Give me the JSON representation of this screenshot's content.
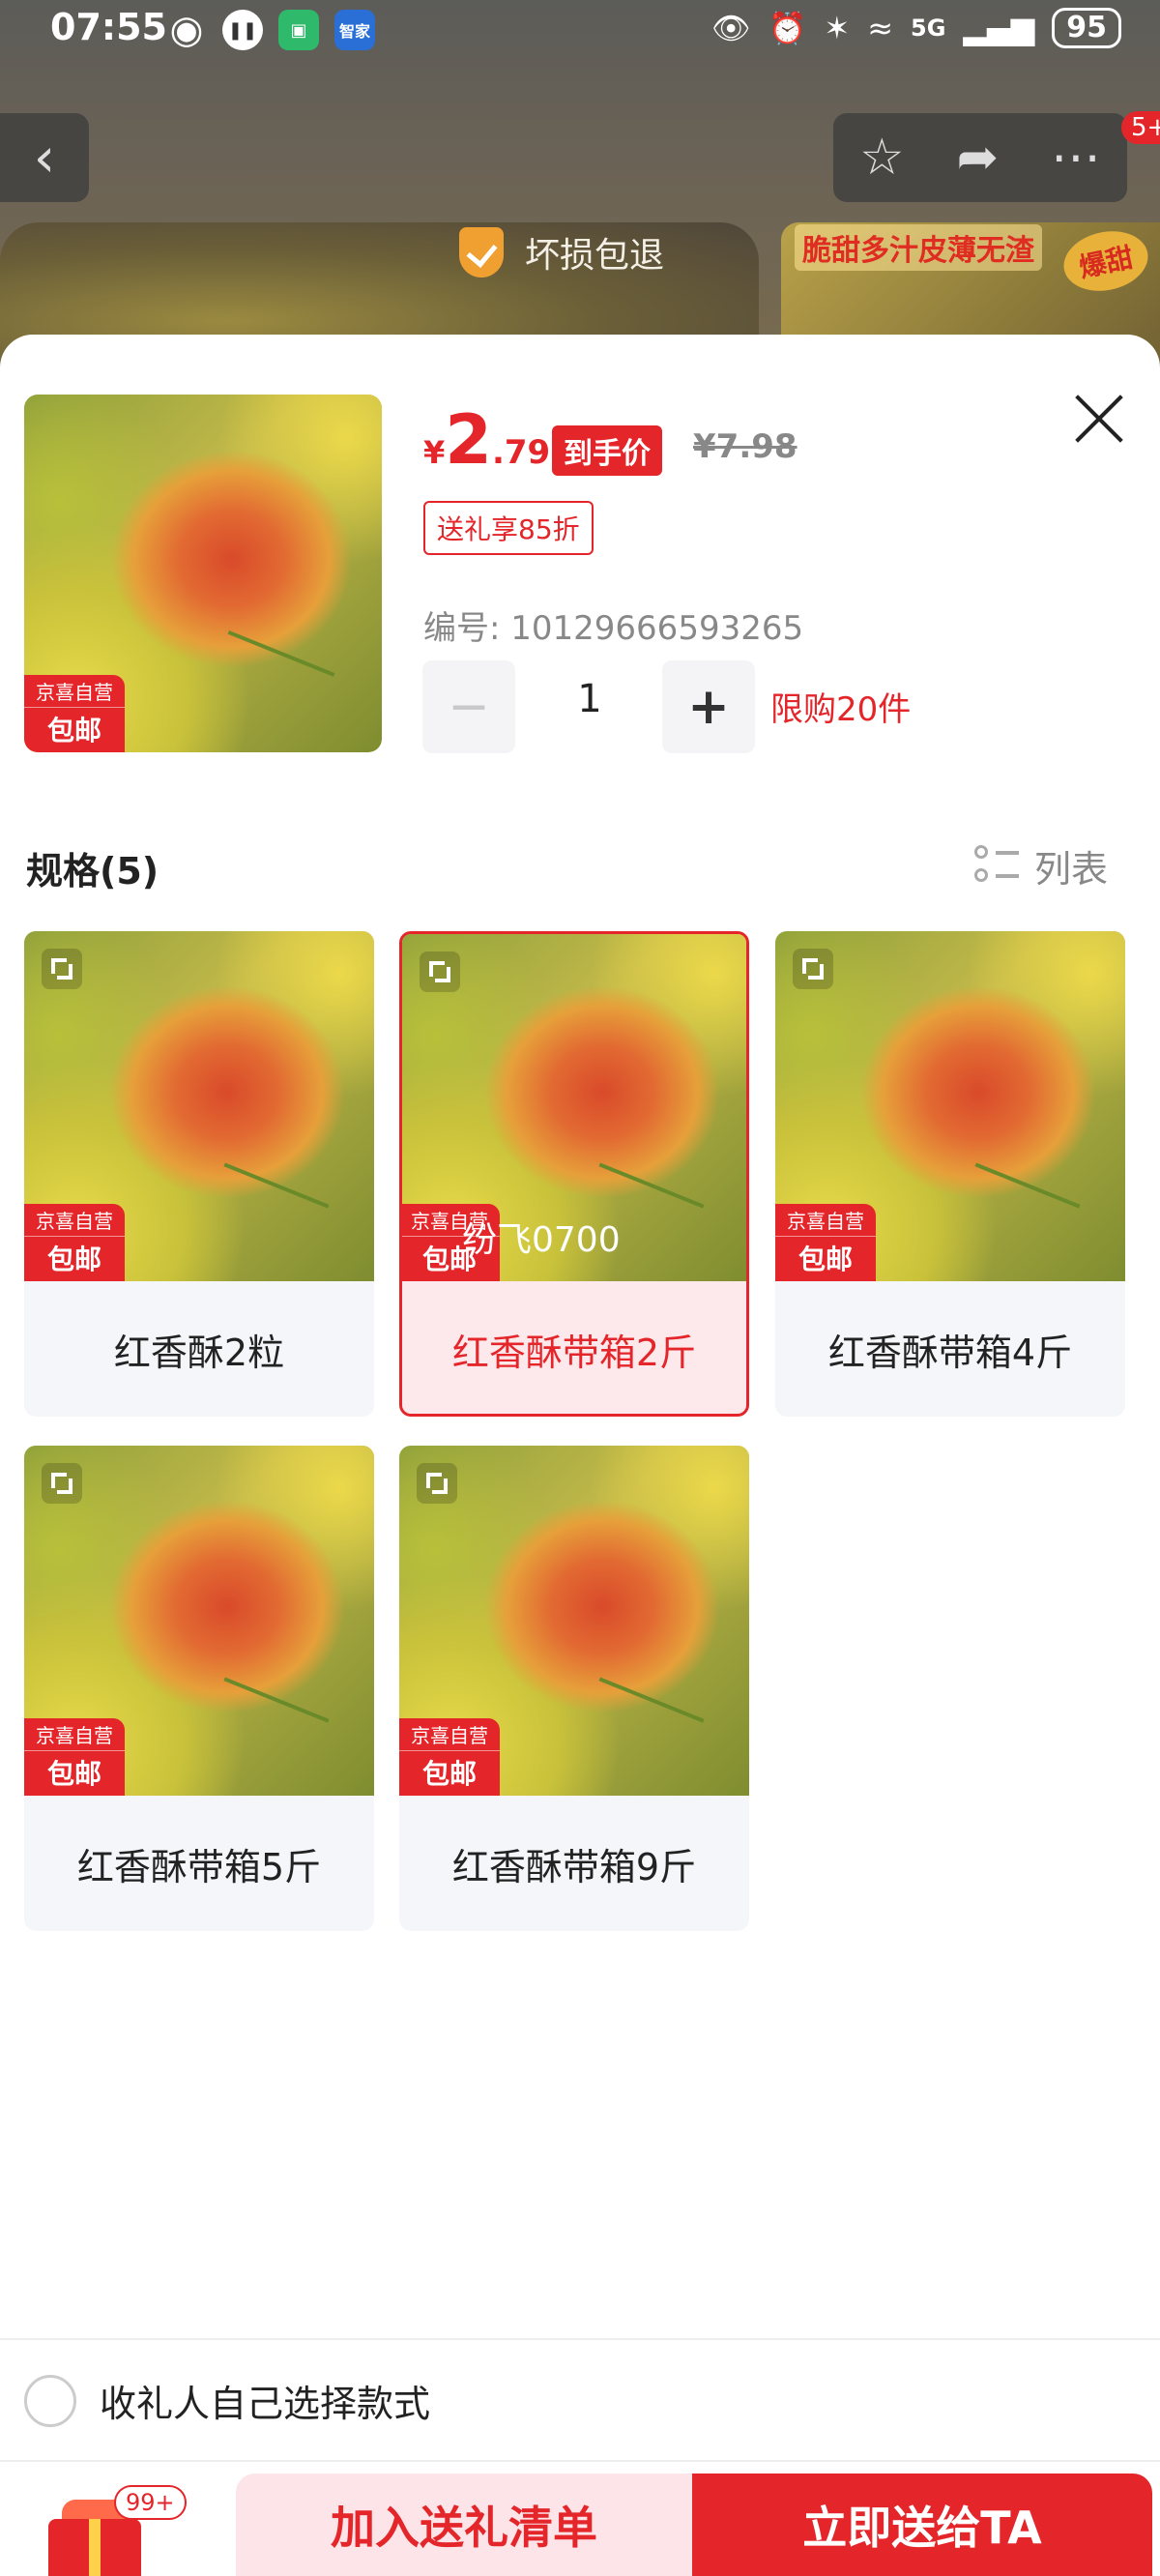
{
  "status_bar": {
    "time": "07:55",
    "app_badge": "智家",
    "network": "5G",
    "battery": "95"
  },
  "background": {
    "damage_tag": "坏损包退",
    "thumb_text": "脆甜多汁皮薄无渣",
    "thumb_badge": "爆甜",
    "nav_badge": "5+"
  },
  "product": {
    "currency": "¥",
    "price_int": "2",
    "price_dec": ".79",
    "price_tag": "到手价",
    "original_price": "¥7.98",
    "gift_discount": "送礼享85折",
    "sku_number": "编号: 10129666593265",
    "quantity": "1",
    "limit": "限购20件",
    "badge_top": "京喜自营",
    "badge_bottom": "包邮"
  },
  "specs": {
    "title": "规格(5)",
    "list_toggle": "列表",
    "watermark": "纷飞0700",
    "items": [
      {
        "label": "红香酥2粒",
        "selected": false
      },
      {
        "label": "红香酥带箱2斤",
        "selected": true
      },
      {
        "label": "红香酥带箱4斤",
        "selected": false
      },
      {
        "label": "红香酥带箱5斤",
        "selected": false
      },
      {
        "label": "红香酥带箱9斤",
        "selected": false
      }
    ]
  },
  "footer": {
    "self_choose": "收礼人自己选择款式",
    "gift_count": "99+",
    "add_to_gift_list": "加入送礼清单",
    "send_now": "立即送给TA"
  },
  "colors": {
    "accent": "#e4262b",
    "selected_bg": "#fde9ec"
  }
}
